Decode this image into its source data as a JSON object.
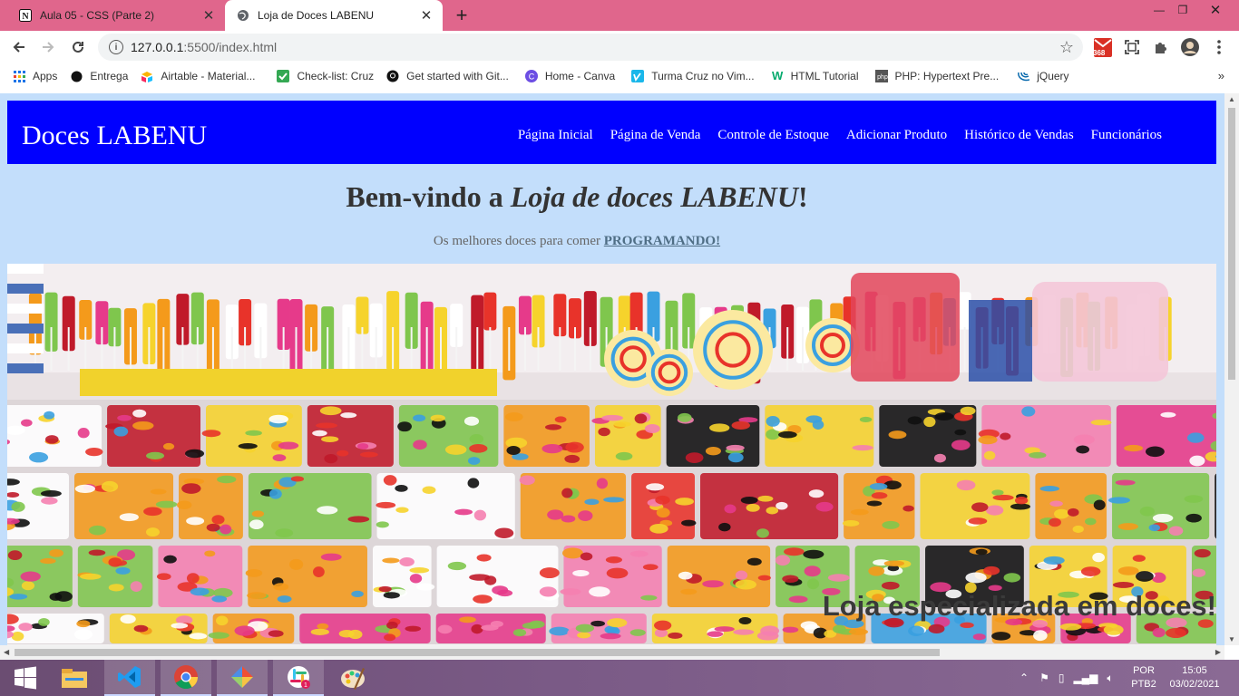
{
  "tabs": [
    {
      "title": "Aula 05 - CSS (Parte 2)",
      "favicon": "notion-icon",
      "active": false
    },
    {
      "title": "Loja de Doces LABENU",
      "favicon": "globe-icon",
      "active": true
    }
  ],
  "omnibox": {
    "host": "127.0.0.1",
    "path": ":5500/index.html"
  },
  "extensions": {
    "badge_count": "368"
  },
  "bookmarks": [
    {
      "label": "Apps",
      "icon": "apps-grid-icon"
    },
    {
      "label": "Entrega",
      "icon": "circle-icon"
    },
    {
      "label": "Airtable - Material...",
      "icon": "airtable-icon"
    },
    {
      "label": "Check-list: Cruz",
      "icon": "checkbox-icon"
    },
    {
      "label": "Get started with Git...",
      "icon": "github-icon"
    },
    {
      "label": "Home - Canva",
      "icon": "canva-icon"
    },
    {
      "label": "Turma Cruz no Vim...",
      "icon": "vimeo-icon"
    },
    {
      "label": "HTML Tutorial",
      "icon": "w3schools-icon"
    },
    {
      "label": "PHP: Hypertext Pre...",
      "icon": "php-icon"
    },
    {
      "label": "jQuery",
      "icon": "jquery-icon"
    }
  ],
  "site": {
    "logo": "Doces LABENU",
    "nav": [
      "Página Inicial",
      "Página de Venda",
      "Controle de Estoque",
      "Adicionar Produto",
      "Histórico de Vendas",
      "Funcionários"
    ],
    "welcome_prefix": "Bem-vindo a ",
    "welcome_emph": "Loja de doces LABENU",
    "welcome_suffix": "!",
    "subtitle_text": "Os melhores doces para comer ",
    "subtitle_link": "PROGRAMANDO!",
    "hero_caption": "Loja especializada em doces!"
  },
  "taskbar": {
    "apps": [
      "start-icon",
      "file-explorer-icon",
      "vscode-icon",
      "chrome-icon",
      "git-icon",
      "slack-icon",
      "paint-icon"
    ],
    "lang_top": "POR",
    "lang_bottom": "PTB2",
    "time": "15:05",
    "date": "03/02/2021"
  },
  "colors": {
    "tabstrip": "#e0668c",
    "site_header": "#0000ff",
    "page_bg": "#c3defb"
  }
}
